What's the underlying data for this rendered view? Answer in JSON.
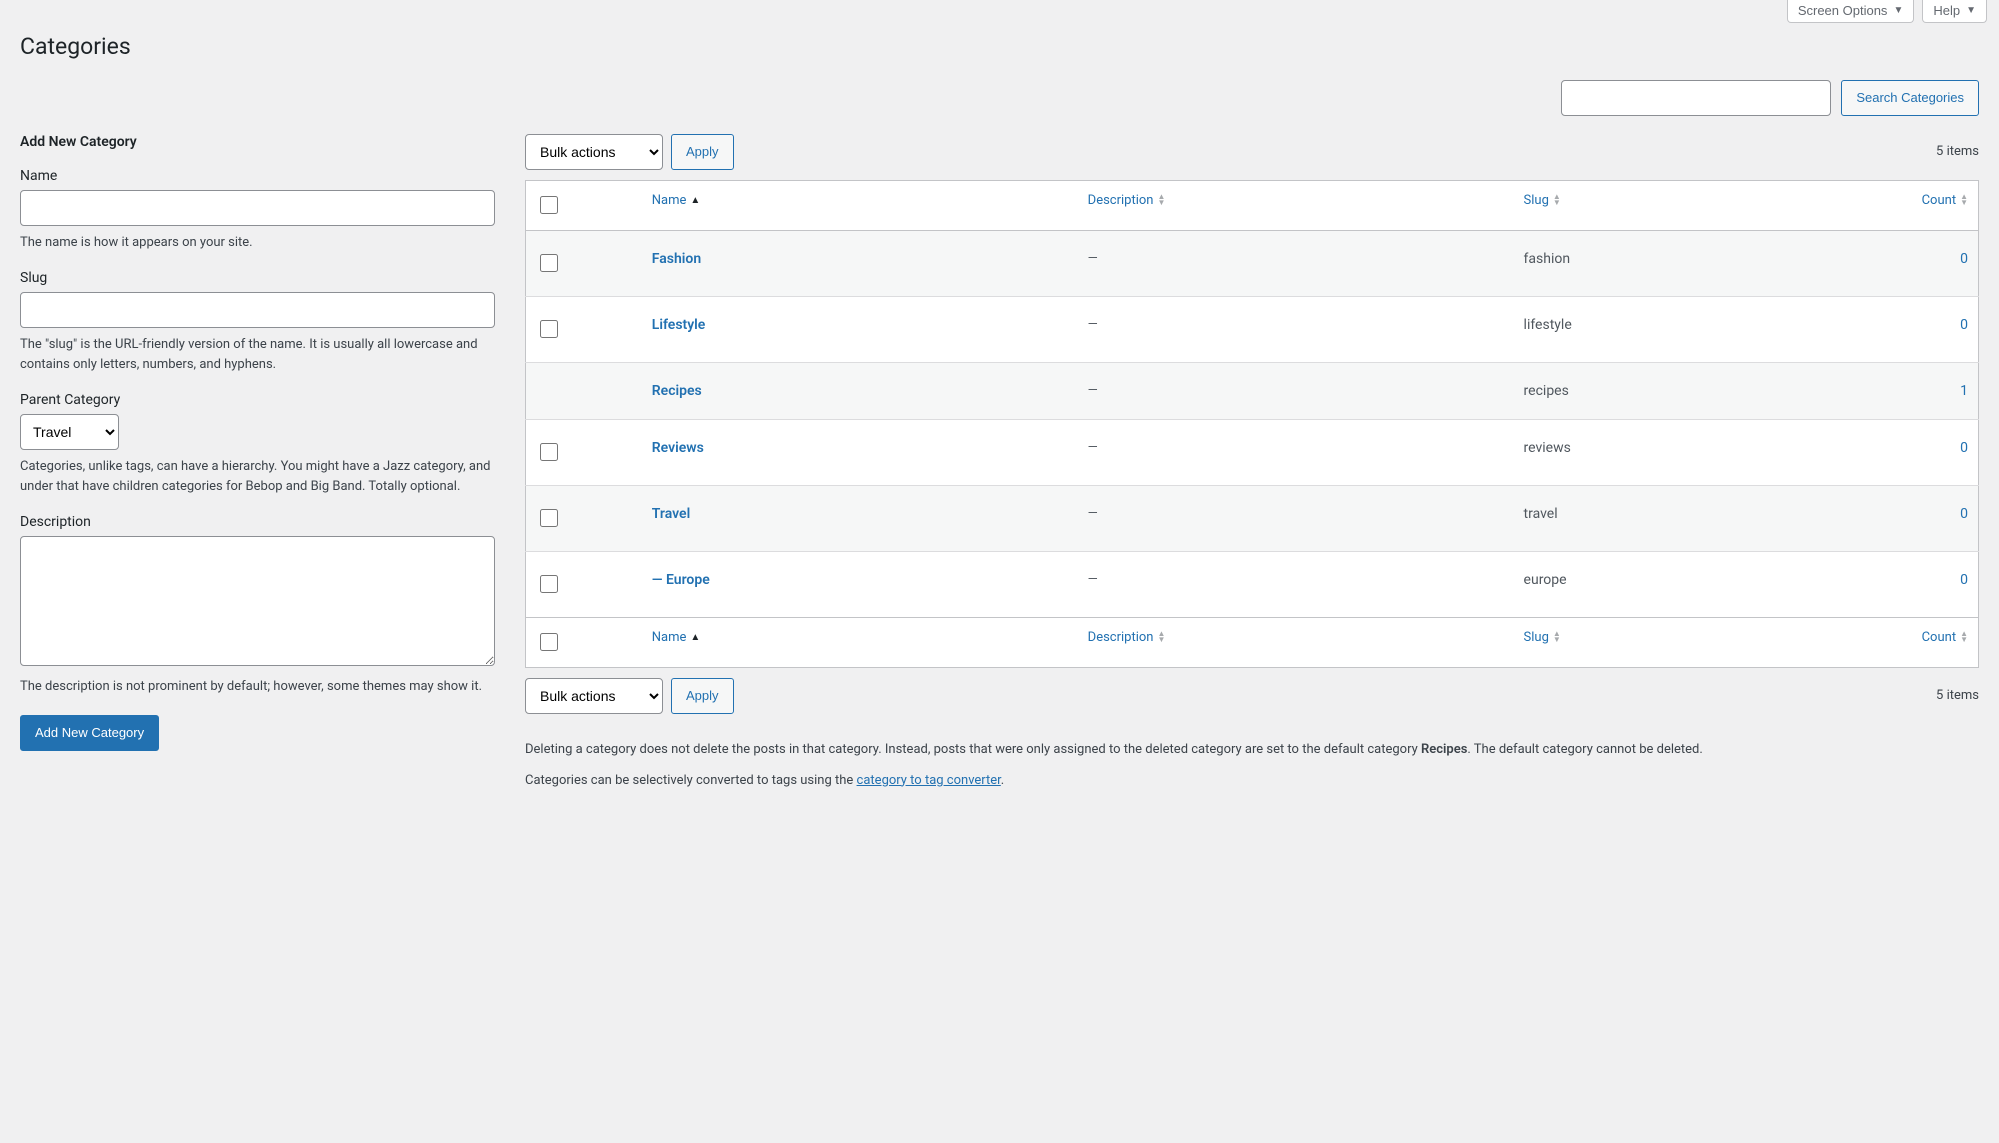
{
  "topTabs": {
    "screenOptions": "Screen Options",
    "help": "Help"
  },
  "pageTitle": "Categories",
  "search": {
    "placeholder": "",
    "button": "Search Categories"
  },
  "form": {
    "title": "Add New Category",
    "name": {
      "label": "Name",
      "desc": "The name is how it appears on your site."
    },
    "slug": {
      "label": "Slug",
      "desc": "The \"slug\" is the URL-friendly version of the name. It is usually all lowercase and contains only letters, numbers, and hyphens."
    },
    "parent": {
      "label": "Parent Category",
      "selected": "Travel",
      "desc": "Categories, unlike tags, can have a hierarchy. You might have a Jazz category, and under that have children categories for Bebop and Big Band. Totally optional."
    },
    "description": {
      "label": "Description",
      "desc": "The description is not prominent by default; however, some themes may show it."
    },
    "submit": "Add New Category"
  },
  "table": {
    "bulkActionsLabel": "Bulk actions",
    "applyLabel": "Apply",
    "itemCount": "5 items",
    "columns": {
      "name": "Name",
      "description": "Description",
      "slug": "Slug",
      "count": "Count"
    },
    "rows": [
      {
        "name": "Fashion",
        "desc": "—",
        "slug": "fashion",
        "count": "0",
        "indent": false
      },
      {
        "name": "Lifestyle",
        "desc": "—",
        "slug": "lifestyle",
        "count": "0",
        "indent": false
      },
      {
        "name": "Recipes",
        "desc": "—",
        "slug": "recipes",
        "count": "1",
        "indent": false,
        "nocheckbox": true
      },
      {
        "name": "Reviews",
        "desc": "—",
        "slug": "reviews",
        "count": "0",
        "indent": false
      },
      {
        "name": "Travel",
        "desc": "—",
        "slug": "travel",
        "count": "0",
        "indent": false
      },
      {
        "name": "— Europe",
        "desc": "—",
        "slug": "europe",
        "count": "0",
        "indent": true
      }
    ]
  },
  "notes": {
    "p1a": "Deleting a category does not delete the posts in that category. Instead, posts that were only assigned to the deleted category are set to the default category ",
    "p1b": "Recipes",
    "p1c": ". The default category cannot be deleted.",
    "p2a": "Categories can be selectively converted to tags using the ",
    "p2link": "category to tag converter",
    "p2b": "."
  }
}
